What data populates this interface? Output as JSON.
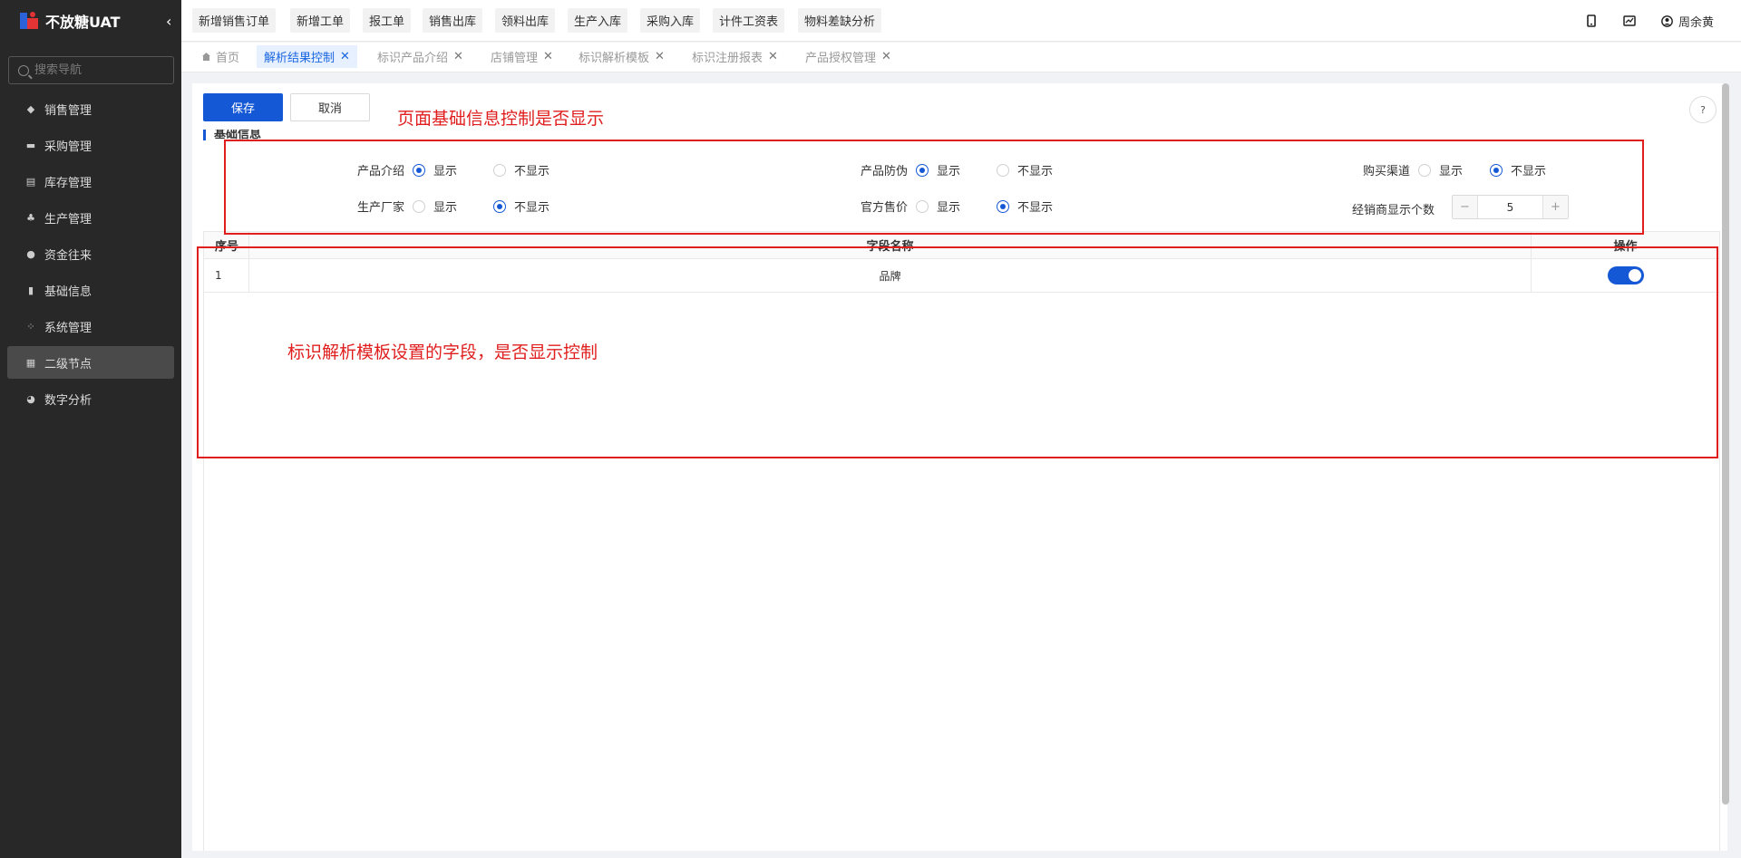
{
  "app": {
    "name": "不放糖UAT",
    "collapse_icon": "chevron-left-icon"
  },
  "sidebar": {
    "search_placeholder": "搜索导航",
    "items": [
      {
        "label": "销售管理",
        "icon": "tag-icon"
      },
      {
        "label": "采购管理",
        "icon": "cart-icon"
      },
      {
        "label": "库存管理",
        "icon": "inventory-icon"
      },
      {
        "label": "生产管理",
        "icon": "production-icon"
      },
      {
        "label": "资金往来",
        "icon": "money-icon"
      },
      {
        "label": "基础信息",
        "icon": "chart-bar-icon"
      },
      {
        "label": "系统管理",
        "icon": "grid-icon"
      },
      {
        "label": "二级节点",
        "icon": "document-icon"
      },
      {
        "label": "数字分析",
        "icon": "pie-chart-icon"
      }
    ],
    "active_item": "二级节点"
  },
  "topbar": {
    "quick_actions": [
      "新增销售订单",
      "新增工单",
      "报工单",
      "销售出库",
      "领料出库",
      "生产入库",
      "采购入库",
      "计件工资表",
      "物料差缺分析"
    ],
    "user_name": "周余黄"
  },
  "tabs": [
    {
      "label": "首页",
      "closable": false
    },
    {
      "label": "解析结果控制",
      "closable": true,
      "active": true
    },
    {
      "label": "标识产品介绍",
      "closable": true
    },
    {
      "label": "店铺管理",
      "closable": true
    },
    {
      "label": "标识解析模板",
      "closable": true
    },
    {
      "label": "标识注册报表",
      "closable": true
    },
    {
      "label": "产品授权管理",
      "closable": true
    }
  ],
  "toolbar": {
    "save_label": "保存",
    "cancel_label": "取消"
  },
  "section": {
    "title": "基础信息"
  },
  "fields": {
    "product_intro": {
      "label": "产品介绍",
      "show": "显示",
      "hide": "不显示",
      "selected": "显示"
    },
    "anti_counterfeit": {
      "label": "产品防伪",
      "show": "显示",
      "hide": "不显示",
      "selected": "显示"
    },
    "purchase_channel": {
      "label": "购买渠道",
      "show": "显示",
      "hide": "不显示",
      "selected": "不显示"
    },
    "manufacturer": {
      "label": "生产厂家",
      "show": "显示",
      "hide": "不显示",
      "selected": "不显示"
    },
    "official_price": {
      "label": "官方售价",
      "show": "显示",
      "hide": "不显示",
      "selected": "不显示"
    },
    "dealer_count": {
      "label": "经销商显示个数",
      "value": "5",
      "minus": "−",
      "plus": "+"
    }
  },
  "table": {
    "headers": [
      "序号",
      "字段名称",
      "操作"
    ],
    "rows": [
      {
        "index": "1",
        "name": "品牌",
        "enabled": true
      }
    ]
  },
  "annotations": {
    "top": "页面基础信息控制是否显示",
    "table": "标识解析模板设置的字段，是否显示控制"
  },
  "colors": {
    "primary": "#1558d6",
    "annotation": "#e01e1e",
    "sidebar_bg": "#282828"
  }
}
